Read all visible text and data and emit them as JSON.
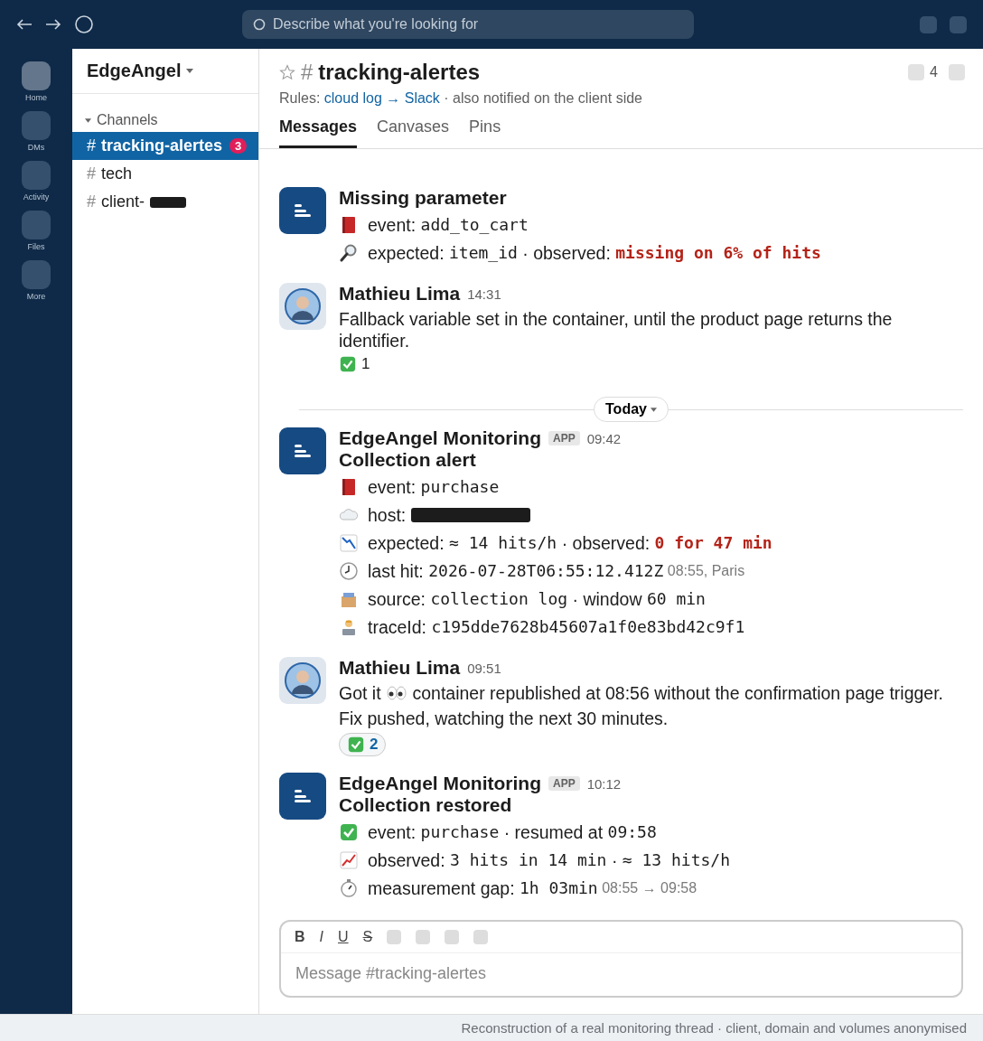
{
  "topbar": {
    "search": {
      "placeholder": "Describe what you're looking for"
    }
  },
  "rail": [
    {
      "label": "Home",
      "selected": true
    },
    {
      "label": "DMs",
      "selected": false
    },
    {
      "label": "Activity",
      "selected": false
    },
    {
      "label": "Files",
      "selected": false
    },
    {
      "label": "More",
      "selected": false
    }
  ],
  "sidebar": {
    "workspace": "EdgeAngel",
    "section": "Channels",
    "channels": [
      {
        "prefix": "#",
        "name": "tracking-alertes",
        "selected": true,
        "badge": "3",
        "redacted": false
      },
      {
        "prefix": "#",
        "name": "tech",
        "selected": false,
        "redacted": false
      },
      {
        "prefix": "#",
        "name": "client-",
        "selected": false,
        "redacted": true
      }
    ]
  },
  "channel": {
    "hash": "#",
    "name": "tracking-alertes",
    "members": "4",
    "rules": [
      {
        "kind": "text",
        "text": "Rules: "
      },
      {
        "kind": "link",
        "text": "cloud log → Slack"
      },
      {
        "kind": "text",
        "text": " · also notified on the client side"
      }
    ],
    "tabs": [
      {
        "label": "Messages",
        "selected": true
      },
      {
        "label": "Canvases",
        "selected": false
      },
      {
        "label": "Pins",
        "selected": false
      }
    ]
  },
  "feed": [
    {
      "kind": "bot",
      "title": "Missing parameter",
      "lines": [
        {
          "kind": "event",
          "segments": [
            {
              "kind": "text",
              "text": "event: "
            },
            {
              "kind": "code",
              "text": "add_to_cart"
            }
          ]
        },
        {
          "kind": "search",
          "segments": [
            {
              "kind": "text",
              "text": "expected: "
            },
            {
              "kind": "code",
              "text": "item_id"
            },
            {
              "kind": "text",
              "text": " · observed: "
            },
            {
              "kind": "alert",
              "text": "missing on 6% of hits"
            }
          ]
        }
      ]
    },
    {
      "kind": "user",
      "author": "Mathieu Lima",
      "time": "14:31",
      "lines": [
        {
          "kind": "plain",
          "segments": [
            {
              "kind": "text",
              "text": "Fallback variable set in the container, until the product page returns the identifier."
            }
          ]
        }
      ],
      "reactions": [
        {
          "count": "1",
          "selected": false
        }
      ]
    },
    {
      "kind": "divider",
      "label": "Today"
    },
    {
      "kind": "bot",
      "author": "EdgeAngel Monitoring",
      "tag": "APP",
      "time": "09:42",
      "title": "Collection alert",
      "lines": [
        {
          "kind": "event",
          "segments": [
            {
              "kind": "text",
              "text": "event: "
            },
            {
              "kind": "code",
              "text": "purchase"
            }
          ]
        },
        {
          "kind": "host",
          "segments": [
            {
              "kind": "text",
              "text": "host: "
            },
            {
              "kind": "redacted"
            }
          ]
        },
        {
          "kind": "drop",
          "segments": [
            {
              "kind": "text",
              "text": "expected: "
            },
            {
              "kind": "code",
              "text": "≈ 14 hits/h"
            },
            {
              "kind": "text",
              "text": " · observed: "
            },
            {
              "kind": "alert",
              "text": "0 for 47 min"
            }
          ]
        },
        {
          "kind": "time",
          "segments": [
            {
              "kind": "text",
              "text": "last hit: "
            },
            {
              "kind": "code",
              "text": "2026-07-28T06:55:12.412Z"
            },
            {
              "kind": "muted",
              "text": " 08:55, Paris"
            }
          ]
        },
        {
          "kind": "source",
          "segments": [
            {
              "kind": "text",
              "text": "source: "
            },
            {
              "kind": "code",
              "text": "collection log"
            },
            {
              "kind": "text",
              "text": " · window "
            },
            {
              "kind": "code",
              "text": "60 min"
            }
          ]
        },
        {
          "kind": "trace",
          "segments": [
            {
              "kind": "text",
              "text": "traceId: "
            },
            {
              "kind": "code",
              "text": "c195dde7628b45607a1f0e83bd42c9f1"
            }
          ]
        }
      ]
    },
    {
      "kind": "user",
      "author": "Mathieu Lima",
      "time": "09:51",
      "lines": [
        {
          "kind": "plain",
          "segments": [
            {
              "kind": "text",
              "text": "Got it "
            },
            {
              "kind": "emoji"
            },
            {
              "kind": "text",
              "text": " container republished at 08:56 without the confirmation page trigger."
            }
          ]
        },
        {
          "kind": "plain",
          "segments": [
            {
              "kind": "text",
              "text": "Fix pushed, watching the next 30 minutes."
            }
          ]
        }
      ],
      "reactions": [
        {
          "count": "2",
          "selected": true
        }
      ]
    },
    {
      "kind": "bot",
      "author": "EdgeAngel Monitoring",
      "tag": "APP",
      "time": "10:12",
      "title": "Collection restored",
      "lines": [
        {
          "kind": "done",
          "segments": [
            {
              "kind": "text",
              "text": "event: "
            },
            {
              "kind": "code",
              "text": "purchase"
            },
            {
              "kind": "text",
              "text": " · resumed at "
            },
            {
              "kind": "code",
              "text": "09:58"
            }
          ]
        },
        {
          "kind": "rise",
          "segments": [
            {
              "kind": "text",
              "text": "observed: "
            },
            {
              "kind": "code",
              "text": "3 hits in 14 min"
            },
            {
              "kind": "text",
              "text": " · "
            },
            {
              "kind": "code",
              "text": "≈ 13 hits/h"
            }
          ]
        },
        {
          "kind": "duration",
          "segments": [
            {
              "kind": "text",
              "text": "measurement gap: "
            },
            {
              "kind": "code",
              "text": "1h 03min"
            },
            {
              "kind": "muted",
              "text": " 08:55 → 09:58"
            }
          ]
        }
      ]
    }
  ],
  "composer": {
    "format": [
      {
        "kind": "bold",
        "label": "B"
      },
      {
        "kind": "italic",
        "label": "I"
      },
      {
        "kind": "underline",
        "label": "U"
      },
      {
        "kind": "strike",
        "label": "S"
      }
    ],
    "placeholder": "Message #tracking-alertes"
  },
  "footer": "Reconstruction of a real monitoring thread · client, domain and volumes anonymised"
}
